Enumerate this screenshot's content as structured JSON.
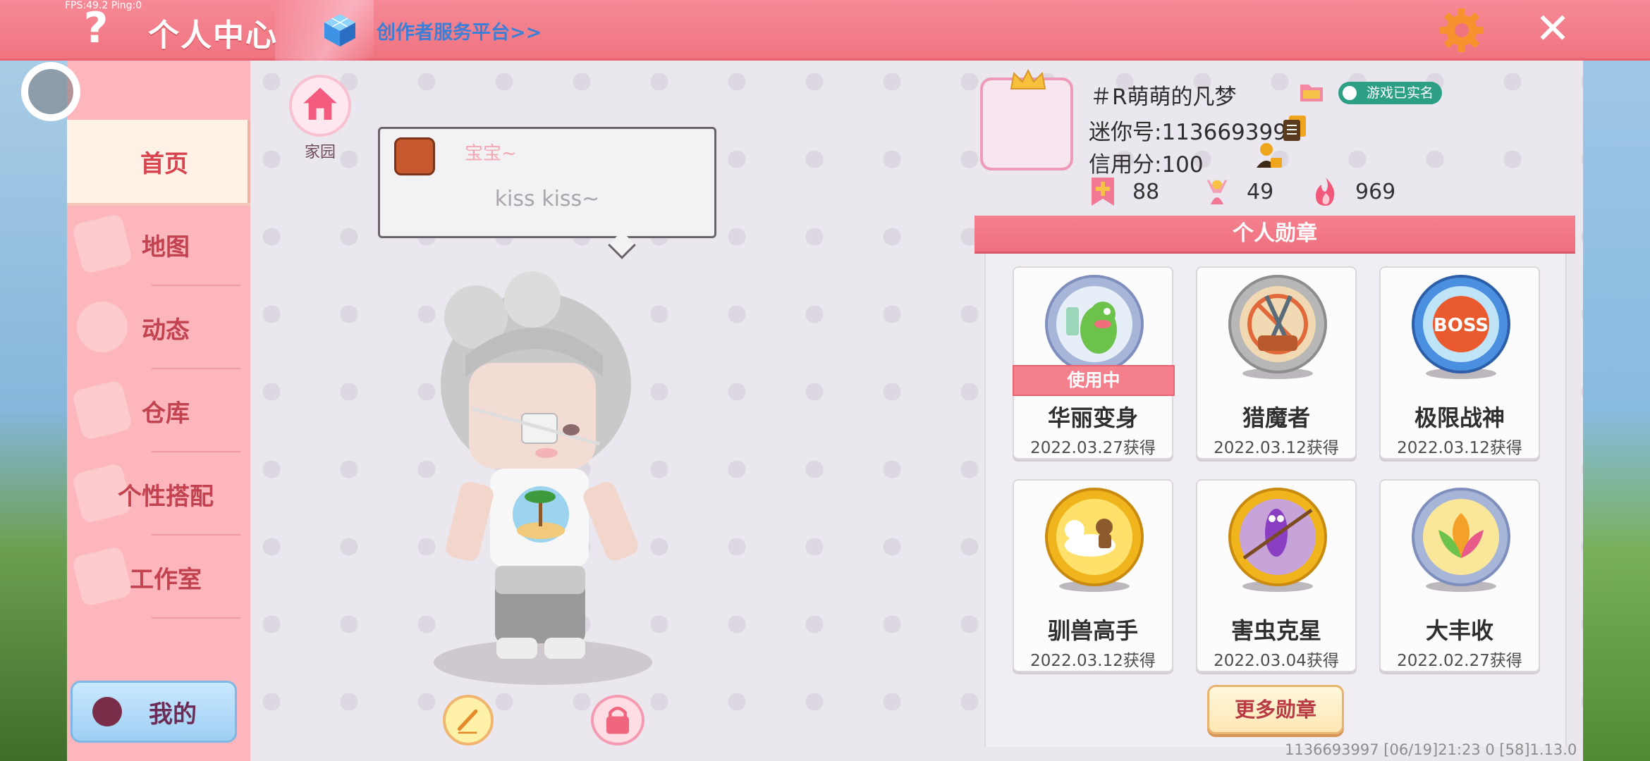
{
  "header": {
    "fps": "FPS:49.2  Ping:0",
    "title": "个人中心",
    "creator_link": "创作者服务平台>>"
  },
  "sidebar": {
    "items": [
      {
        "label": "首页",
        "active": true
      },
      {
        "label": "地图",
        "active": false
      },
      {
        "label": "动态",
        "active": false
      },
      {
        "label": "仓库",
        "active": false
      },
      {
        "label": "个性搭配",
        "active": false
      },
      {
        "label": "工作室",
        "active": false
      }
    ],
    "my_label": "我的"
  },
  "home": {
    "label": "家园"
  },
  "bubble": {
    "name": "宝宝~",
    "text": "kiss kiss~"
  },
  "profile": {
    "nickname": "＃R萌萌的凡梦",
    "verified": "游戏已实名",
    "mini_id": "迷你号:1136693997",
    "credit": "信用分:100",
    "stats": [
      {
        "icon": "bookmark-plus-icon",
        "value": "88"
      },
      {
        "icon": "cheer-icon",
        "value": "49"
      },
      {
        "icon": "flame-icon",
        "value": "969"
      }
    ]
  },
  "medals": {
    "title": "个人勋章",
    "items": [
      {
        "name": "华丽变身",
        "date": "2022.03.27获得",
        "in_use": true,
        "badge": "使用中",
        "icon": "dino-medal-icon"
      },
      {
        "name": "猎魔者",
        "date": "2022.03.12获得",
        "in_use": false,
        "icon": "sword-shield-medal-icon"
      },
      {
        "name": "极限战神",
        "date": "2022.03.12获得",
        "in_use": false,
        "icon": "boss-medal-icon"
      },
      {
        "name": "驯兽高手",
        "date": "2022.03.12获得",
        "in_use": false,
        "icon": "horse-medal-icon"
      },
      {
        "name": "害虫克星",
        "date": "2022.03.04获得",
        "in_use": false,
        "icon": "worm-medal-icon"
      },
      {
        "name": "大丰收",
        "date": "2022.02.27获得",
        "in_use": false,
        "icon": "harvest-medal-icon"
      }
    ],
    "more_label": "更多勋章"
  },
  "footer": "1136693997   [06/19]21:23 0   [58]1.13.0",
  "colors": {
    "header": "#ef7480",
    "sidebar": "#fcb6bc",
    "accent": "#d8434f",
    "panel": "#f1eef3"
  }
}
